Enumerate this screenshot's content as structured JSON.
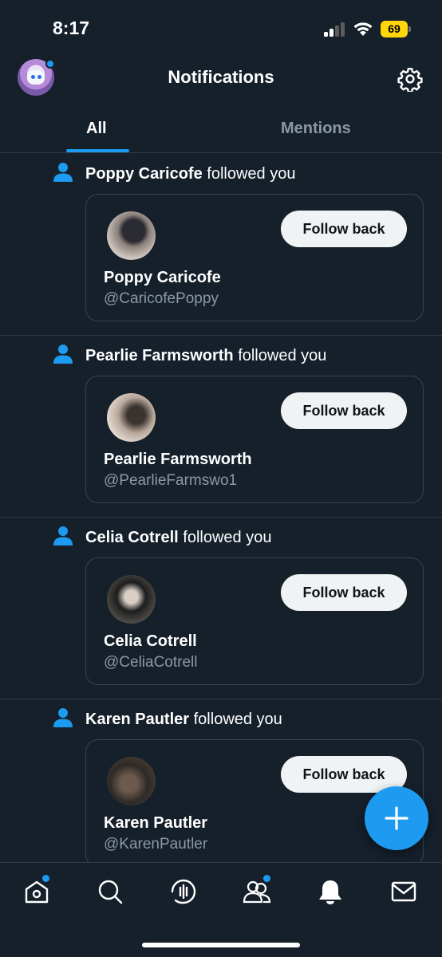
{
  "status_bar": {
    "time": "8:17",
    "battery": "69",
    "battery_color": "#ffd60a"
  },
  "header": {
    "title": "Notifications",
    "left_icon": "profile-avatar",
    "right_icon": "gear-icon"
  },
  "tabs": [
    {
      "label": "All",
      "selected": true
    },
    {
      "label": "Mentions",
      "selected": false
    }
  ],
  "notifications": [
    {
      "name": "Poppy Caricofe",
      "action": "followed you",
      "handle": "@CaricofePoppy",
      "button": "Follow back"
    },
    {
      "name": "Pearlie Farmsworth",
      "action": "followed you",
      "handle": "@PearlieFarmswo1",
      "button": "Follow back"
    },
    {
      "name": "Celia Cotrell",
      "action": "followed you",
      "handle": "@CeliaCotrell",
      "button": "Follow back"
    },
    {
      "name": "Karen Pautler",
      "action": "followed you",
      "handle": "@KarenPautler",
      "button": "Follow back"
    }
  ],
  "fab": {
    "icon": "plus-icon"
  },
  "bottom_nav": [
    {
      "icon": "home-icon",
      "badge": true
    },
    {
      "icon": "search-icon",
      "badge": false
    },
    {
      "icon": "spaces-icon",
      "badge": false
    },
    {
      "icon": "communities-icon",
      "badge": true
    },
    {
      "icon": "bell-icon",
      "badge": false
    },
    {
      "icon": "mail-icon",
      "badge": false
    }
  ],
  "colors": {
    "background": "#15202b",
    "accent": "#1d9bf0",
    "secondary_text": "#8b98a5",
    "divider": "#2f3b47"
  }
}
